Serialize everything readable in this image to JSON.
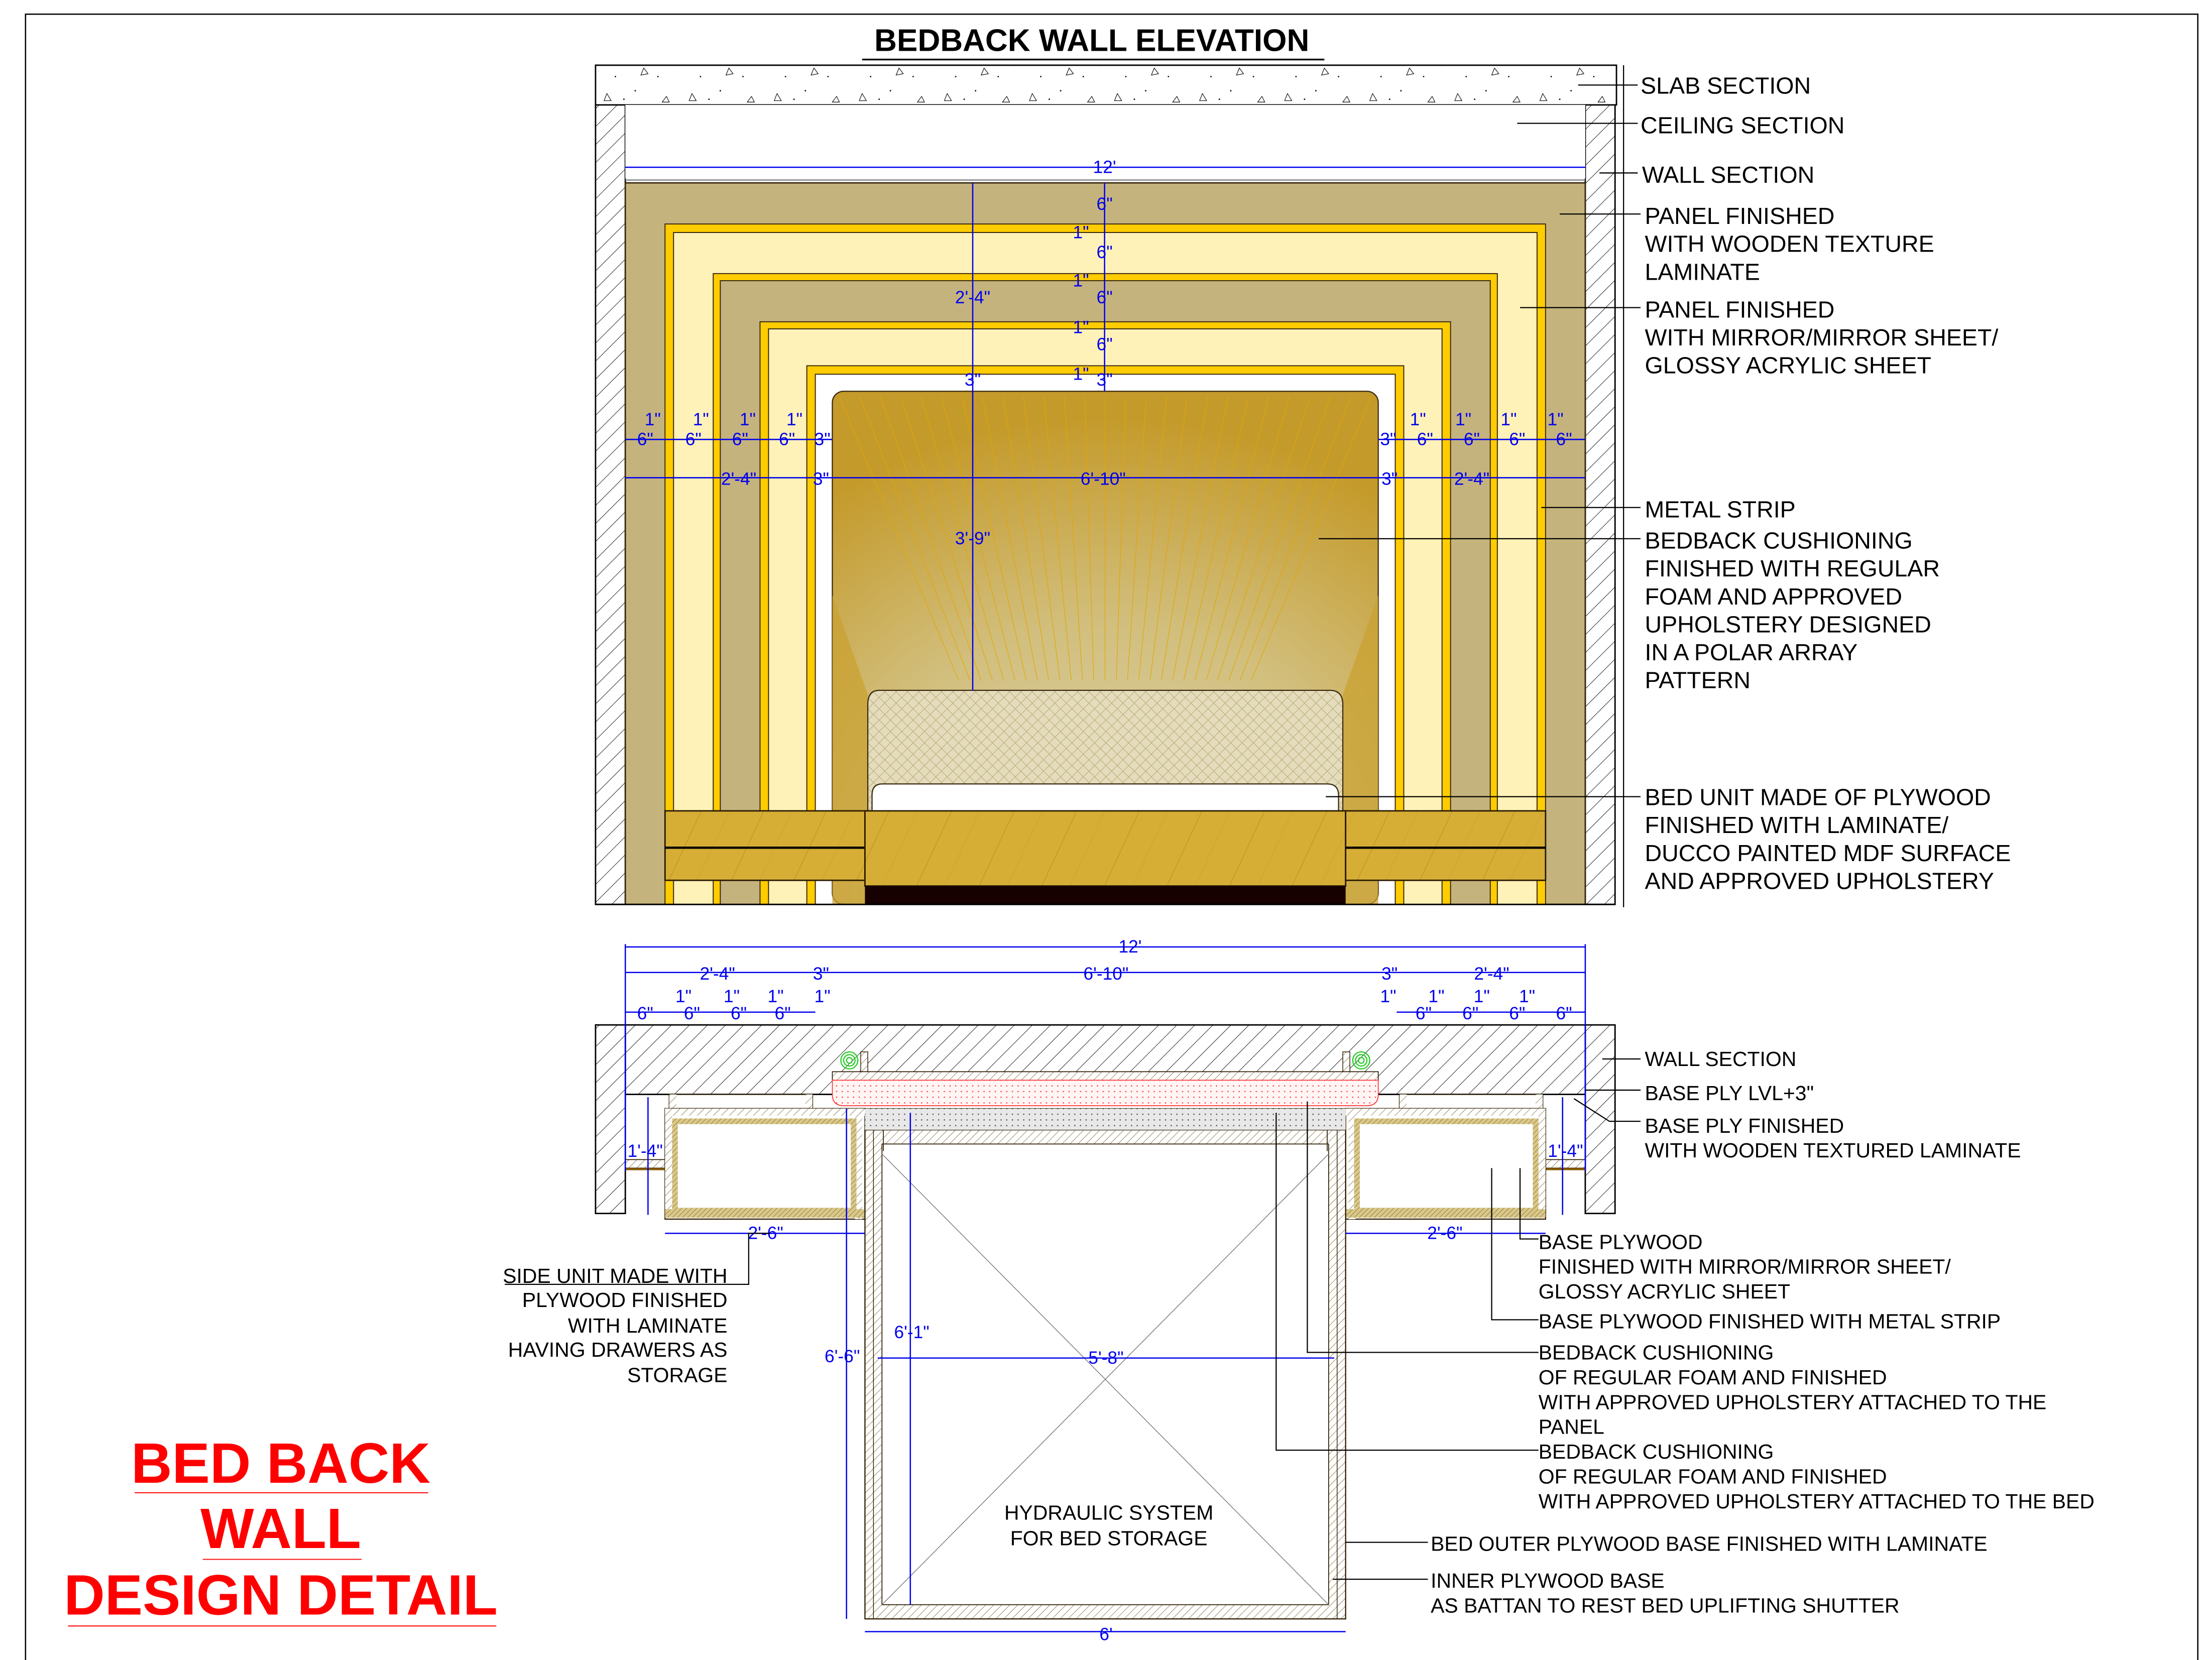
{
  "sheet": {
    "title": "BEDBACK WALL ELEVATION",
    "drawing_title_lines": [
      "BED BACK",
      "WALL",
      "DESIGN DETAIL"
    ]
  },
  "colors": {
    "panel_wood": "#c5b37e",
    "panel_mirror": "#fff2b8",
    "metal_strip": "#ffcc00",
    "cushion_gold": "#c9a232",
    "cushion_light": "#d8cfa3",
    "bed_body": "#d4ae35",
    "bed_base": "#170000",
    "dimension": "#0000ee",
    "title_red": "#ff0000",
    "foam_red": "#ff3030",
    "pivot_green": "#22cc22"
  },
  "elevation": {
    "dims": {
      "overall_width": "12'",
      "top_stack": [
        "6\"",
        "1\"",
        "6\"",
        "1\"",
        "6\"",
        "1\"",
        "6\"",
        "1\"",
        "3\""
      ],
      "side_total_vertical": "2'-4\"",
      "cushion_gap_vertical": "3\"",
      "cushion_height": "3'-9\"",
      "left_row_small": [
        "1\"",
        "1\"",
        "1\"",
        "1\""
      ],
      "left_row_mid": [
        "6\"",
        "6\"",
        "6\"",
        "6\"",
        "3\""
      ],
      "right_row_small": [
        "1\"",
        "1\"",
        "1\"",
        "1\""
      ],
      "right_row_mid": [
        "3\"",
        "6\"",
        "6\"",
        "6\"",
        "6\""
      ],
      "left_total": "2'-4\"",
      "left_gap": "3\"",
      "center_width": "6'-10\"",
      "right_gap": "3\"",
      "right_total": "2'-4\""
    },
    "labels": [
      {
        "id": "slab",
        "lines": [
          "SLAB SECTION"
        ]
      },
      {
        "id": "ceiling",
        "lines": [
          "CEILING SECTION"
        ]
      },
      {
        "id": "wall",
        "lines": [
          "WALL SECTION"
        ]
      },
      {
        "id": "panel-wood",
        "lines": [
          "PANEL FINISHED",
          "WITH WOODEN TEXTURE",
          "LAMINATE"
        ]
      },
      {
        "id": "panel-mirror",
        "lines": [
          "PANEL FINISHED",
          "WITH MIRROR/MIRROR SHEET/",
          "GLOSSY ACRYLIC SHEET"
        ]
      },
      {
        "id": "metal-strip",
        "lines": [
          "METAL STRIP"
        ]
      },
      {
        "id": "cushioning",
        "lines": [
          "BEDBACK CUSHIONING",
          "FINISHED WITH REGULAR",
          "FOAM AND APPROVED",
          "UPHOLSTERY DESIGNED",
          "IN A POLAR ARRAY",
          "PATTERN"
        ]
      },
      {
        "id": "bed-unit",
        "lines": [
          "BED UNIT MADE OF PLYWOOD",
          "FINISHED WITH LAMINATE/",
          "DUCCO PAINTED MDF SURFACE",
          "AND APPROVED UPHOLSTERY"
        ]
      }
    ]
  },
  "plan": {
    "dims": {
      "overall_width": "12'",
      "left_total": "2'-4\"",
      "left_gap": "3\"",
      "center_width": "6'-10\"",
      "right_gap": "3\"",
      "right_total": "2'-4\"",
      "left_small": [
        "1\"",
        "1\"",
        "1\"",
        "1\""
      ],
      "left_mid": [
        "6\"",
        "6\"",
        "6\"",
        "6\""
      ],
      "right_small": [
        "1\"",
        "1\"",
        "1\"",
        "1\""
      ],
      "right_mid": [
        "6\"",
        "6\"",
        "6\"",
        "6\""
      ],
      "side_depth_left": "1'-4\"",
      "side_depth_right": "1'-4\"",
      "side_width_left": "2'-6\"",
      "side_width_right": "2'-6\"",
      "bed_inner_length": "6'-1\"",
      "bed_outer_length": "6'-6\"",
      "bed_inner_width": "5'-8\"",
      "bed_outer_width": "6'"
    },
    "center_note": [
      "HYDRAULIC SYSTEM",
      "FOR BED STORAGE"
    ],
    "side_unit_note": [
      "SIDE UNIT MADE WITH",
      "PLYWOOD FINISHED",
      "WITH LAMINATE",
      "HAVING DRAWERS AS",
      "STORAGE"
    ],
    "labels": [
      {
        "id": "wall",
        "lines": [
          "WALL SECTION"
        ]
      },
      {
        "id": "base-ply-lvl",
        "lines": [
          "BASE PLY LVL+3\""
        ]
      },
      {
        "id": "base-ply-finished",
        "lines": [
          "BASE PLY FINISHED",
          "WITH WOODEN TEXTURED LAMINATE"
        ]
      },
      {
        "id": "base-plywood-mirror",
        "lines": [
          "BASE PLYWOOD",
          "FINISHED WITH MIRROR/MIRROR SHEET/",
          "GLOSSY ACRYLIC SHEET"
        ]
      },
      {
        "id": "base-plywood-metal",
        "lines": [
          "BASE PLYWOOD FINISHED WITH METAL STRIP"
        ]
      },
      {
        "id": "cushion-panel",
        "lines": [
          "BEDBACK CUSHIONING",
          "OF REGULAR FOAM AND FINISHED",
          "WITH APPROVED UPHOLSTERY ATTACHED TO THE",
          "PANEL"
        ]
      },
      {
        "id": "cushion-bed",
        "lines": [
          "BEDBACK CUSHIONING",
          "OF REGULAR FOAM AND FINISHED",
          "WITH APPROVED UPHOLSTERY ATTACHED TO THE BED"
        ]
      },
      {
        "id": "bed-outer",
        "lines": [
          "BED OUTER PLYWOOD BASE FINISHED WITH LAMINATE"
        ]
      },
      {
        "id": "inner-base",
        "lines": [
          "INNER PLYWOOD BASE",
          "AS BATTAN TO REST BED UPLIFTING SHUTTER"
        ]
      }
    ]
  }
}
